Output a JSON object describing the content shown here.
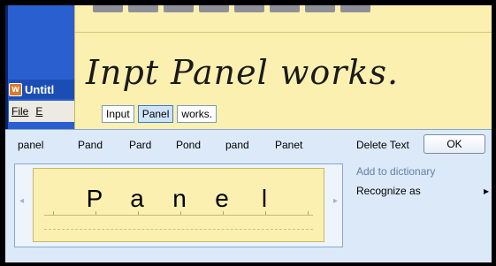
{
  "background_window": {
    "title": "Untitl",
    "menu": [
      "File",
      "E"
    ]
  },
  "writing_pad": {
    "ink_text": "Inpt Panel works.",
    "recognized_words": [
      "Input",
      "Panel",
      "works."
    ],
    "selected_index": 1
  },
  "correction_panel": {
    "alternates": [
      "panel",
      "Pand",
      "Pard",
      "Pond",
      "pand",
      "Panet"
    ],
    "delete_label": "Delete Text",
    "ok_label": "OK",
    "letters": [
      "P",
      "a",
      "n",
      "e",
      "l"
    ],
    "menu_items": [
      "Add to dictionary",
      "Recognize as"
    ],
    "arrow_left": "◂",
    "arrow_right": "▸",
    "chevron": "▸"
  },
  "colors": {
    "writing_bg": "#fbf0b0",
    "panel_bg": "#dbe9f9",
    "selected_word": "#cfe4fa",
    "xp_blue": "#2b61c9"
  }
}
